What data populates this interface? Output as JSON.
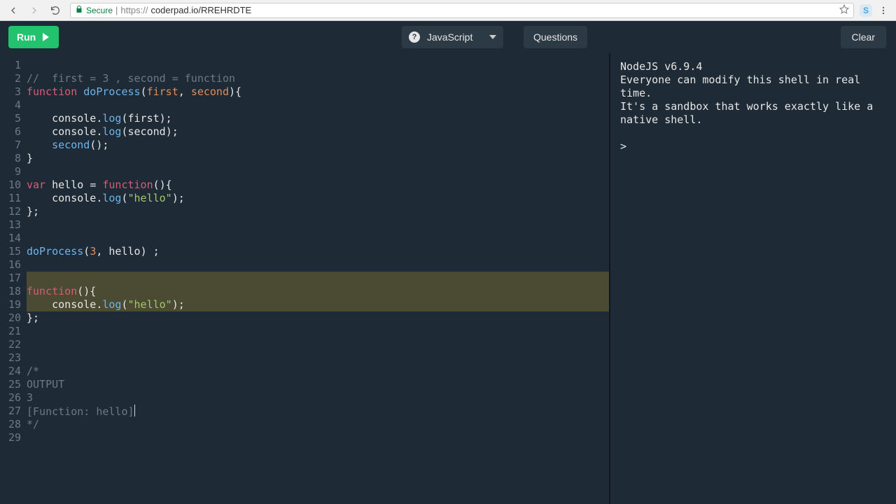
{
  "browser": {
    "secure_label": "Secure",
    "url_prefix": "https://",
    "url_host": "coderpad.io/RREHRDTE"
  },
  "toolbar": {
    "run_label": "Run",
    "language_label": "JavaScript",
    "questions_label": "Questions",
    "clear_label": "Clear"
  },
  "editor": {
    "line_count": 29,
    "highlight_lines": [
      17,
      18,
      19
    ],
    "cursor_line": 27,
    "lines": [
      [],
      [
        [
          "c-comment",
          "//  first = 3 , second = function"
        ]
      ],
      [
        [
          "c-keyword",
          "function"
        ],
        [
          "c-ident",
          " "
        ],
        [
          "c-func",
          "doProcess"
        ],
        [
          "c-punct",
          "("
        ],
        [
          "c-param",
          "first"
        ],
        [
          "c-punct",
          ", "
        ],
        [
          "c-param",
          "second"
        ],
        [
          "c-punct",
          "){"
        ]
      ],
      [],
      [
        [
          "c-ident",
          "    console"
        ],
        [
          "c-punct",
          "."
        ],
        [
          "c-call",
          "log"
        ],
        [
          "c-punct",
          "("
        ],
        [
          "c-ident",
          "first"
        ],
        [
          "c-punct",
          ");"
        ]
      ],
      [
        [
          "c-ident",
          "    console"
        ],
        [
          "c-punct",
          "."
        ],
        [
          "c-call",
          "log"
        ],
        [
          "c-punct",
          "("
        ],
        [
          "c-ident",
          "second"
        ],
        [
          "c-punct",
          ");"
        ]
      ],
      [
        [
          "c-ident",
          "    "
        ],
        [
          "c-call",
          "second"
        ],
        [
          "c-punct",
          "();"
        ]
      ],
      [
        [
          "c-punct",
          "}"
        ]
      ],
      [],
      [
        [
          "c-keyword",
          "var"
        ],
        [
          "c-ident",
          " hello "
        ],
        [
          "c-punct",
          "= "
        ],
        [
          "c-keyword",
          "function"
        ],
        [
          "c-punct",
          "(){"
        ]
      ],
      [
        [
          "c-ident",
          "    console"
        ],
        [
          "c-punct",
          "."
        ],
        [
          "c-call",
          "log"
        ],
        [
          "c-punct",
          "("
        ],
        [
          "c-string",
          "\"hello\""
        ],
        [
          "c-punct",
          ");"
        ]
      ],
      [
        [
          "c-punct",
          "};"
        ]
      ],
      [],
      [],
      [
        [
          "c-func",
          "doProcess"
        ],
        [
          "c-punct",
          "("
        ],
        [
          "c-number",
          "3"
        ],
        [
          "c-punct",
          ", "
        ],
        [
          "c-ident",
          "hello"
        ],
        [
          "c-punct",
          ") ;"
        ]
      ],
      [],
      [],
      [
        [
          "c-keyword",
          "function"
        ],
        [
          "c-punct",
          "(){"
        ]
      ],
      [
        [
          "c-ident",
          "    console"
        ],
        [
          "c-punct",
          "."
        ],
        [
          "c-call",
          "log"
        ],
        [
          "c-punct",
          "("
        ],
        [
          "c-string",
          "\"hello\""
        ],
        [
          "c-punct",
          ");"
        ]
      ],
      [
        [
          "c-punct",
          "};"
        ]
      ],
      [],
      [],
      [],
      [
        [
          "c-comment",
          "/*"
        ]
      ],
      [
        [
          "c-comment",
          "OUTPUT"
        ]
      ],
      [
        [
          "c-comment",
          "3"
        ]
      ],
      [
        [
          "c-comment",
          "[Function: hello]"
        ]
      ],
      [
        [
          "c-comment",
          "*/"
        ]
      ],
      []
    ]
  },
  "terminal": {
    "lines": [
      "NodeJS v6.9.4",
      "Everyone can modify this shell in real time.",
      "It's a sandbox that works exactly like a native shell.",
      "",
      "> "
    ]
  }
}
